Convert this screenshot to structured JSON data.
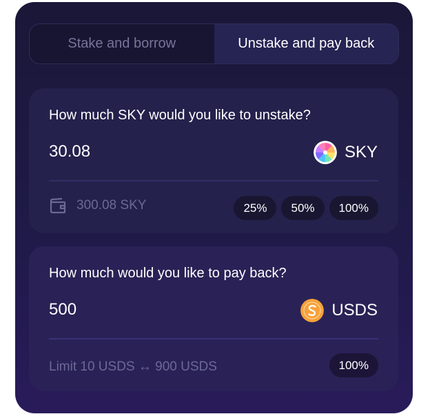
{
  "tabs": [
    {
      "label": "Stake and borrow",
      "active": false
    },
    {
      "label": "Unstake and pay back",
      "active": true
    }
  ],
  "unstake": {
    "question": "How much SKY would you like to unstake?",
    "amount": "30.08",
    "token": {
      "symbol": "SKY",
      "icon": "sky-token-icon"
    },
    "balance": "300.08 SKY",
    "percent_buttons": [
      "25%",
      "50%",
      "100%"
    ]
  },
  "payback": {
    "question": "How much would you like to pay back?",
    "amount": "500",
    "token": {
      "symbol": "USDS",
      "icon": "usds-token-icon"
    },
    "limit": "Limit 10 USDS ↔ 900 USDS",
    "percent_buttons": [
      "100%"
    ]
  },
  "colors": {
    "panel_bg": "#1c1940",
    "card_bg": "#24214c",
    "muted_text": "#6c6996",
    "usds_orange": "#f7a23a"
  }
}
